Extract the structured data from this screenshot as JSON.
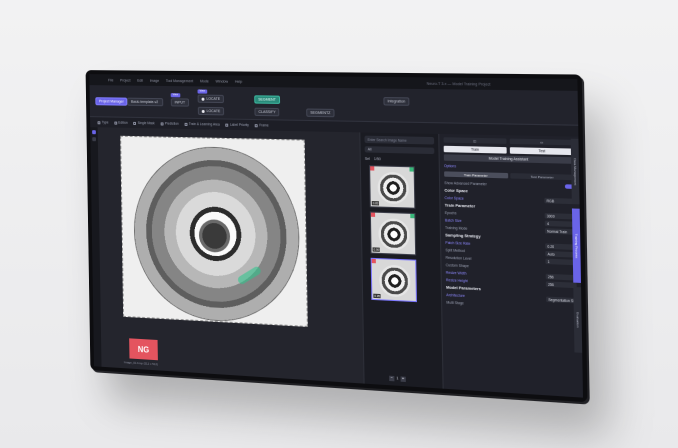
{
  "menu": [
    "File",
    "Project",
    "Edit",
    "Image",
    "Tool Management",
    "Mode",
    "Window",
    "Help"
  ],
  "window_title": "Neuro-T 3.x — Model Training Project",
  "toolbar": {
    "project_label": "Project Manager",
    "workspace": "Basic-template-v2",
    "nodes": [
      "INPUT",
      "LOCATE",
      "LOCATE",
      "SEGMENT",
      "CLASSIFY",
      "SEGMENTZ"
    ],
    "tag": "View",
    "integration": "Integration"
  },
  "checks": [
    "Type",
    "Edition",
    "Single Mask",
    "Prediction",
    "Train & Learning Area",
    "Label Priority",
    "Frame"
  ],
  "viewer": {
    "badge": "NG",
    "note": "Image_01.bmp  (512 x 512)"
  },
  "thumbs": {
    "search_placeholder": "Enter Search Image Name",
    "filter": "All",
    "count_label": "Sel",
    "count": "1/50",
    "items": [
      {
        "label": "0.83",
        "flags": [
          "r",
          "g"
        ],
        "selected": false
      },
      {
        "label": "0.90",
        "flags": [
          "r",
          "g"
        ],
        "selected": false
      },
      {
        "label": "0.95",
        "flags": [
          "r"
        ],
        "selected": true
      }
    ],
    "page": "1"
  },
  "panel": {
    "tabs": [
      "Train",
      "Test"
    ],
    "btn_train": "Train",
    "btn_test": "Test",
    "model_btn": "Model Training Assistant",
    "sub": "Options",
    "seg": [
      "Train Parameter",
      "Test Parameter"
    ],
    "show_advanced": "Show Advanced Parameter",
    "sections": {
      "color": "Color Space",
      "train": "Train Parameter",
      "sampling": "Sampling Strategy",
      "model": "Model Parameters"
    },
    "rows": [
      {
        "k": "Color Space",
        "v": "RGB",
        "accent": true
      },
      {
        "k": "Epochs",
        "v": "3000",
        "accent": false
      },
      {
        "k": "Batch Size",
        "v": "4",
        "accent": true
      },
      {
        "k": "Training Mode",
        "v": "Normal Train",
        "accent": false
      },
      {
        "k": "Patch Size Rate",
        "v": "0.20",
        "accent": true
      },
      {
        "k": "Split Method",
        "v": "Auto",
        "accent": false
      },
      {
        "k": "Resolution Level",
        "v": "1",
        "accent": false
      },
      {
        "k": "Resize Width",
        "v": "256",
        "accent": true
      },
      {
        "k": "Resize Height",
        "v": "256",
        "accent": true
      },
      {
        "k": "Architecture",
        "v": "Segmentation SF",
        "accent": true
      }
    ],
    "custom_shape": "Custom Shape",
    "multi_stage": "Multi Stage"
  },
  "side_tabs": [
    "Data Management",
    "Training Process",
    "Evaluation"
  ]
}
